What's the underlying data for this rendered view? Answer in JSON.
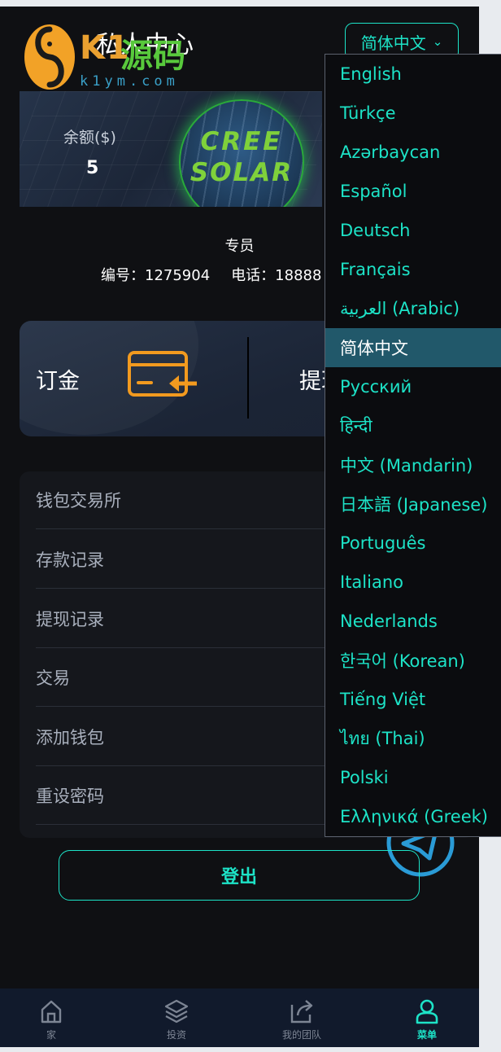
{
  "watermark": {
    "brand_k1": "K1",
    "brand_src": "源码",
    "url": "k1ym.com"
  },
  "header": {
    "title": "私人中心",
    "language_button": {
      "label": "简体中文",
      "chevron": "chevron-down-icon"
    }
  },
  "banner": {
    "balance_label": "余额($)",
    "balance_value": "5",
    "logo_line1": "CREE",
    "logo_line2": "SOLAR"
  },
  "member": {
    "level": "专员",
    "id_text": "编号：1275904",
    "phone_text": "电话：18888"
  },
  "actions": {
    "deposit_label": "订金",
    "withdraw_label": "提现"
  },
  "menu": {
    "items": [
      {
        "label": "钱包交易所"
      },
      {
        "label": "存款记录"
      },
      {
        "label": "提现记录"
      },
      {
        "label": "交易"
      },
      {
        "label": "添加钱包"
      },
      {
        "label": "重设密码"
      }
    ]
  },
  "logout_label": "登出",
  "bottom_nav": {
    "items": [
      {
        "label": "家",
        "icon": "home-icon"
      },
      {
        "label": "投资",
        "icon": "layers-icon"
      },
      {
        "label": "我的团队",
        "icon": "share-icon"
      },
      {
        "label": "菜单",
        "icon": "user-icon",
        "active": true
      }
    ]
  },
  "language_menu": {
    "selected": "简体中文",
    "options": [
      "English",
      "Türkçe",
      "Azərbaycan",
      "Español",
      "Deutsch",
      "Français",
      "العربية (Arabic)",
      "简体中文",
      "Русский",
      "हिन्दी",
      "中文 (Mandarin)",
      "日本語 (Japanese)",
      "Português",
      "Italiano",
      "Nederlands",
      "한국어 (Korean)",
      "Tiếng Việt",
      "ไทย (Thai)",
      "Polski",
      "Ελληνικά (Greek)"
    ]
  },
  "colors": {
    "accent": "#1de3c7",
    "background": "#0f1013",
    "nav_bg": "#111a2c",
    "selected_lang_bg": "#21586a",
    "icon_orange": "#f29a1f"
  }
}
